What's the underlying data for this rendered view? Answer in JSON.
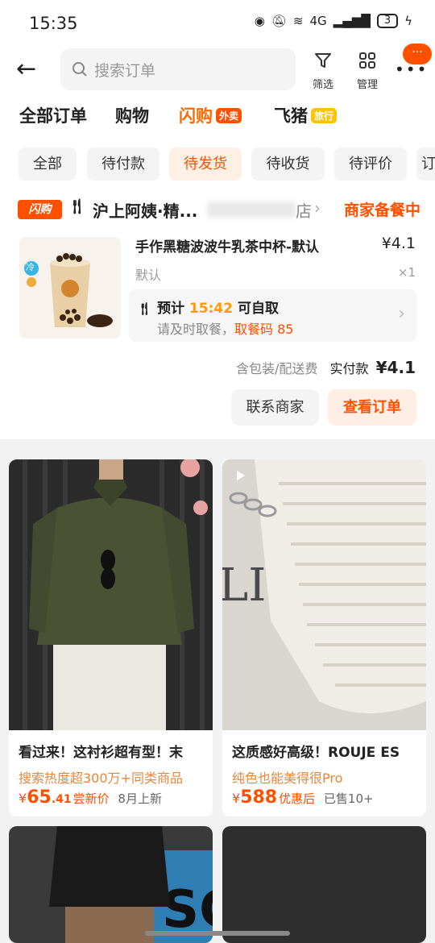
{
  "status_bar": {
    "time": "15:35",
    "network": "4G",
    "battery": "3"
  },
  "header": {
    "search_placeholder": "搜索订单",
    "filter_label": "筛选",
    "manage_label": "管理",
    "more_badge": "···"
  },
  "tabs": [
    {
      "label": "全部订单"
    },
    {
      "label": "购物"
    },
    {
      "label": "闪购",
      "tag": "外卖"
    },
    {
      "label": "飞猪",
      "tag": "旅行"
    }
  ],
  "chips": [
    "全部",
    "待付款",
    "待发货",
    "待收货",
    "待评价",
    "订"
  ],
  "order": {
    "shop_tag": "闪购",
    "shop_name": "沪上阿姨·精...",
    "shop_name_tail": "店",
    "status": "商家备餐中",
    "product_title": "手作黑糖波波牛乳茶中杯-默认",
    "price": "¥4.1",
    "spec": "默认",
    "qty": "×1",
    "pickup_prefix": "预计",
    "pickup_time": "15:42",
    "pickup_suffix": "可自取",
    "pickup_note": "请及时取餐，",
    "pickup_code": "取餐码 85",
    "fee_note": "含包装/配送费",
    "paid_label": "实付款",
    "paid_amount": "¥4.1",
    "btn_contact": "联系商家",
    "btn_view": "查看订单",
    "thumb_badge": "冷"
  },
  "recommendations": [
    {
      "title": "看过来！这衬衫超有型！末",
      "sub": "搜索热度超300万+同类商品",
      "yen": "¥",
      "price_int": "65",
      "price_dec": ".41",
      "price_tag": "尝新价",
      "extra": "8月上新"
    },
    {
      "title": "这质感好高级！ROUJE ES",
      "sub": "纯色也能美得很Pro",
      "yen": "¥",
      "price_int": "588",
      "price_dec": "",
      "price_tag": "优惠后",
      "extra": "已售10+"
    }
  ],
  "colors": {
    "accent": "#ff5000",
    "bg": "#f2f2f2"
  }
}
